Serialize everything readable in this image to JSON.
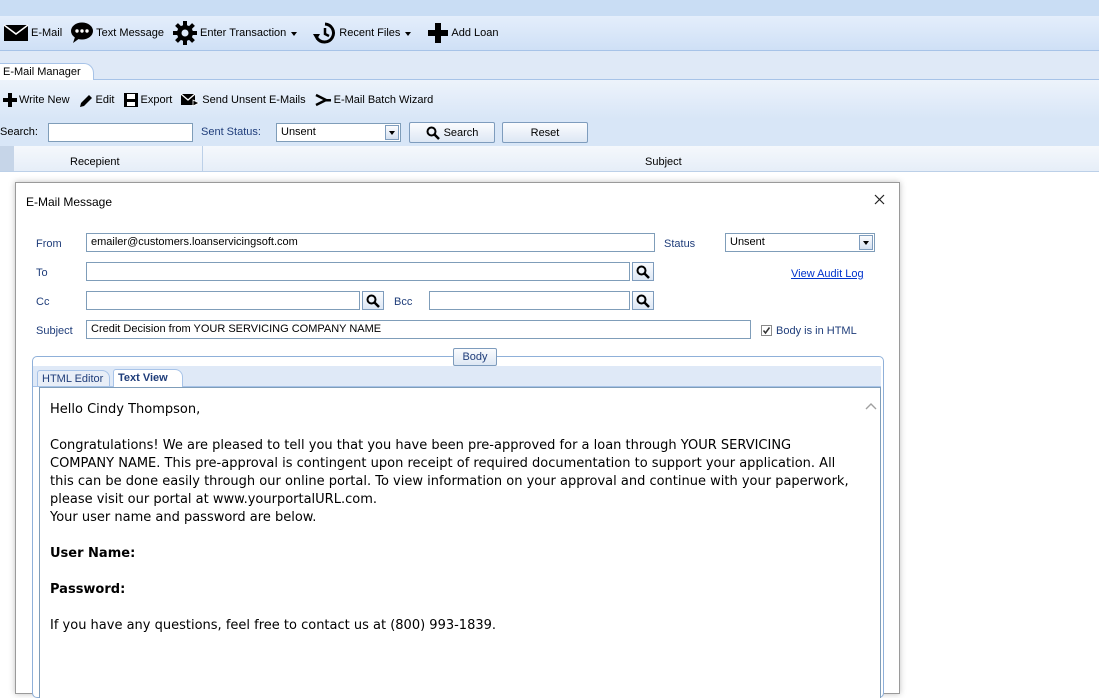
{
  "toolbar": {
    "email": "E-Mail",
    "text_message": "Text Message",
    "enter_transaction": "Enter Transaction",
    "recent_files": "Recent Files",
    "add_loan": "Add Loan"
  },
  "tabs": {
    "email_manager": "E-Mail Manager"
  },
  "sub_toolbar": {
    "write_new": "Write New",
    "edit": "Edit",
    "export": "Export",
    "send_unsent": "Send Unsent E-Mails",
    "batch_wizard": "E-Mail Batch Wizard"
  },
  "search_bar": {
    "search_label": "Search:",
    "search_value": "",
    "sent_status_label": "Sent Status:",
    "sent_status_value": "Unsent",
    "search_button": "Search",
    "reset_button": "Reset"
  },
  "grid": {
    "col_recipient": "Recepient",
    "col_subject": "Subject"
  },
  "dialog": {
    "title": "E-Mail Message",
    "from_label": "From",
    "from_value": "emailer@customers.loanservicingsoft.com",
    "status_label": "Status",
    "status_value": "Unsent",
    "to_label": "To",
    "to_value": "",
    "view_audit_log": "View Audit Log",
    "cc_label": "Cc",
    "cc_value": "",
    "bcc_label": "Bcc",
    "bcc_value": "",
    "subject_label": "Subject",
    "subject_value": "Credit Decision from YOUR SERVICING COMPANY NAME",
    "body_html_label": "Body is in HTML",
    "body_html_checked": true,
    "body_group_label": "Body",
    "tab_html_editor": "HTML Editor",
    "tab_text_view": "Text View",
    "body": {
      "greeting": "Hello Cindy Thompson,",
      "para1": "Congratulations! We are pleased to tell you that you have been pre-approved for a loan through YOUR SERVICING COMPANY NAME. This pre-approval is contingent upon receipt of required documentation to support your application. All this can be done easily through our online portal. To view information on your approval and continue with your paperwork, please visit our portal at www.yourportalURL.com.",
      "para1_line2": "Your user name and password are below.",
      "username_label": "User Name:",
      "password_label": "Password:",
      "closing": "If you have any questions, feel free to contact us at (800) 993-1839."
    }
  }
}
